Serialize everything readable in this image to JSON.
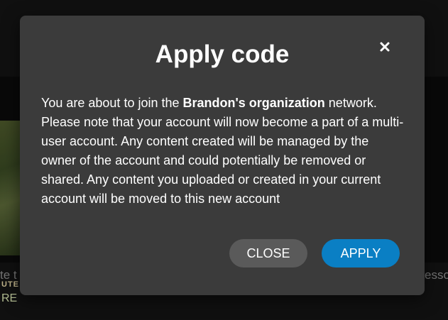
{
  "background": {
    "label_left": "te t",
    "label_right": "esso"
  },
  "dialog": {
    "title": "Apply code",
    "close_icon": "close-icon",
    "message_before": "You are about to join the ",
    "organization_name": "Brandon's organization",
    "message_after": " network. Please note that your account will now become a part of a multi-user account. Any content created will be managed by the owner of the account and could potentially be removed or shared. Any content you uploaded or created in your current account will be moved to this new account",
    "close_button_label": "CLOSE",
    "apply_button_label": "APPLY"
  },
  "colors": {
    "dialog_bg": "#3b3b3b",
    "apply_accent": "#0a7fc4",
    "close_button_bg": "#5a5a5a"
  }
}
